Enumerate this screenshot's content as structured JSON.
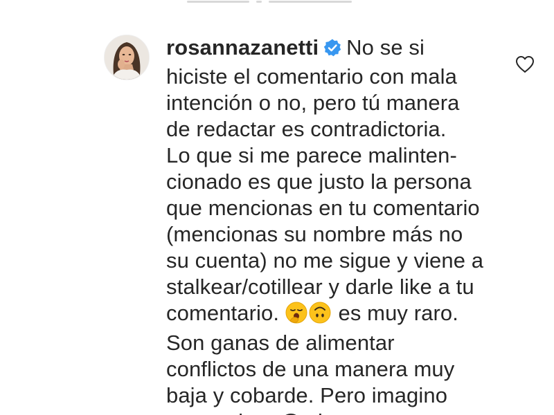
{
  "comment": {
    "username": "rosannazanetti",
    "verified_icon": "verified-badge-icon",
    "lines": [
      "No se si",
      "hiciste el comentario con mala",
      "intención o no, pero tú manera",
      "de redactar es contradictoria.",
      "Lo que si me parece malinten-",
      "cionado es que justo la persona",
      "que mencionas en tu comentario",
      "(mencionas su nombre más no",
      "su cuenta) no me sigue y viene a",
      "stalkear/cotillear y darle like a tu",
      "comentario.",
      "es muy raro.",
      "Son ganas de alimentar",
      "conflictos de una manera muy",
      "baja y cobarde. Pero imagino",
      "que a algun@s les trae cuenta."
    ],
    "emojis": [
      "yawning-face-emoji",
      "upside-down-face-emoji"
    ],
    "like_icon": "heart-outline-icon",
    "colors": {
      "text": "#262626",
      "verified": "#3897f0",
      "background": "#ffffff",
      "icon": "#262626"
    }
  }
}
